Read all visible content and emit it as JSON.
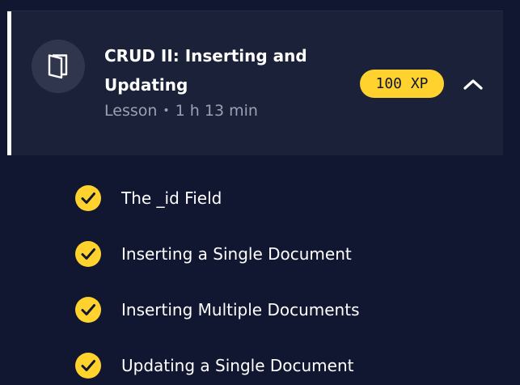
{
  "lesson": {
    "title": "CRUD II: Inserting and Updating",
    "type": "Lesson",
    "separator": "•",
    "duration": "1 h 13 min",
    "xp": "100 XP",
    "icon": "notebook-icon",
    "expanded": true
  },
  "exercises": [
    {
      "label": "The _id Field",
      "completed": true
    },
    {
      "label": "Inserting a Single Document",
      "completed": true
    },
    {
      "label": "Inserting Multiple Documents",
      "completed": true
    },
    {
      "label": "Updating a Single Document",
      "completed": true
    }
  ],
  "colors": {
    "background": "#111631",
    "card": "#1b2139",
    "accent": "#ffd22e",
    "text": "#ffffff",
    "muted": "#9ca0b3"
  }
}
